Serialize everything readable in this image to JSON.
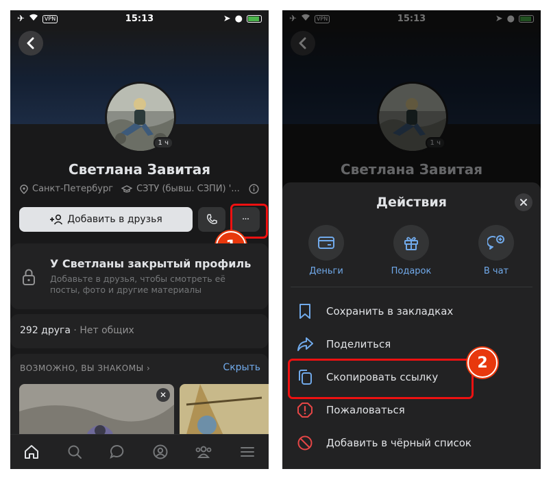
{
  "status_bar": {
    "time": "15:13",
    "vpn": "VPN"
  },
  "profile": {
    "name": "Светлана Завитая",
    "online_badge": "1 ч",
    "city": "Санкт-Петербург",
    "university": "СЗТУ (бывш. СЗПИ) '...",
    "add_friend_label": "Добавить в друзья",
    "more_label": "···",
    "private_title": "У Светланы закрытый профиль",
    "private_desc": "Добавьте в друзья, чтобы смотреть её посты, фото и другие материалы",
    "friends_count": "292 друга",
    "friends_common": "· Нет общих",
    "suggest_header": "ВОЗМОЖНО, ВЫ ЗНАКОМЫ",
    "suggest_hide": "Скрыть"
  },
  "tabbar": {
    "icons": [
      "home-icon",
      "search-icon",
      "messages-icon",
      "profile-icon",
      "friends-icon",
      "menu-icon"
    ]
  },
  "step_badges": [
    "1",
    "2"
  ],
  "sheet": {
    "title": "Действия",
    "quick_actions": [
      {
        "label": "Деньги",
        "icon": "money-icon"
      },
      {
        "label": "Подарок",
        "icon": "gift-icon"
      },
      {
        "label": "В чат",
        "icon": "chat-add-icon"
      }
    ],
    "items": [
      {
        "label": "Сохранить в закладках",
        "icon": "bookmark-icon"
      },
      {
        "label": "Поделиться",
        "icon": "share-icon"
      },
      {
        "label": "Скопировать ссылку",
        "icon": "copy-icon"
      },
      {
        "label": "Пожаловаться",
        "icon": "report-icon"
      },
      {
        "label": "Добавить в чёрный список",
        "icon": "block-icon"
      }
    ]
  },
  "colors": {
    "accent": "#71aaeb",
    "danger": "#e64646",
    "highlight": "#ee1111",
    "badge": "#e8380d"
  }
}
